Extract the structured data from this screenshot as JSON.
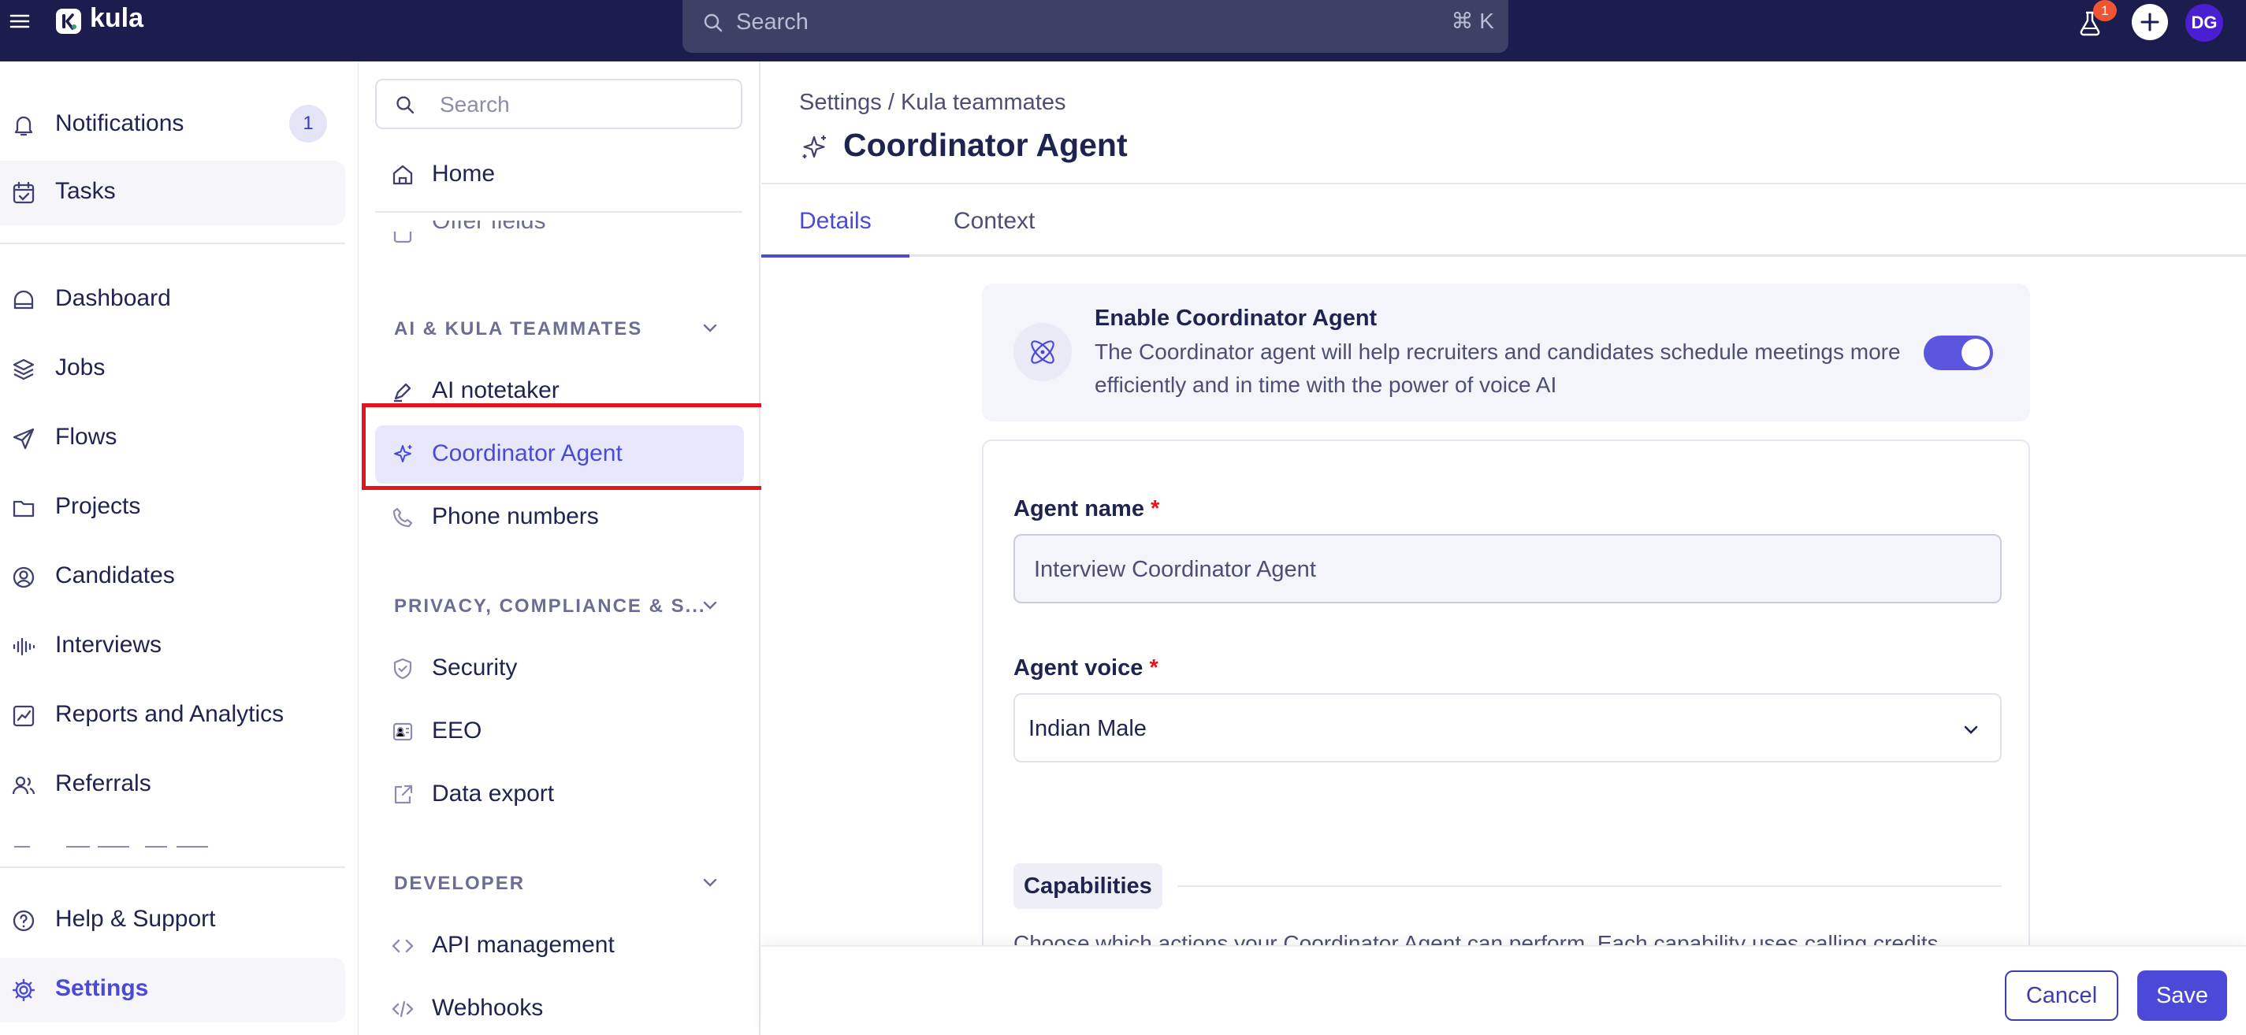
{
  "app": {
    "name": "kula",
    "search_placeholder": "Search",
    "search_shortcut": "⌘ K",
    "lab_badge_count": "1",
    "user_initials": "DG"
  },
  "leftnav": {
    "notifications": "Notifications",
    "notifications_count": "1",
    "tasks": "Tasks",
    "dashboard": "Dashboard",
    "jobs": "Jobs",
    "flows": "Flows",
    "projects": "Projects",
    "candidates": "Candidates",
    "interviews": "Interviews",
    "reports": "Reports and Analytics",
    "referrals": "Referrals",
    "help": "Help & Support",
    "settings": "Settings"
  },
  "subnav": {
    "search_placeholder": "Search",
    "home": "Home",
    "offer_fields": "Offer fields",
    "section_ai": "AI & KULA TEAMMATES",
    "ai_notetaker": "AI notetaker",
    "coordinator_agent": "Coordinator Agent",
    "phone_numbers": "Phone numbers",
    "section_privacy": "PRIVACY, COMPLIANCE & S...",
    "security": "Security",
    "eeo": "EEO",
    "data_export": "Data export",
    "section_developer": "DEVELOPER",
    "api_management": "API management",
    "webhooks": "Webhooks"
  },
  "main": {
    "breadcrumb": "Settings / Kula teammates",
    "title": "Coordinator Agent",
    "tabs": [
      {
        "label": "Details"
      },
      {
        "label": "Context"
      }
    ],
    "enable": {
      "title": "Enable Coordinator Agent",
      "description": "The Coordinator agent will help recruiters and candidates schedule meetings more efficiently and in time with the power of voice AI",
      "enabled": true
    },
    "agent_name_label": "Agent name",
    "agent_name_value": "Interview Coordinator Agent",
    "agent_voice_label": "Agent voice",
    "agent_voice_value": "Indian Male",
    "required_mark": "*",
    "capabilities_label": "Capabilities",
    "capabilities_desc": "Choose which actions your Coordinator Agent can perform. Each capability uses calling credits when active."
  },
  "footer": {
    "cancel": "Cancel",
    "save": "Save"
  },
  "colors": {
    "topbar": "#1c1c4e",
    "accent": "#4b49d8",
    "highlight": "#e5131b"
  }
}
